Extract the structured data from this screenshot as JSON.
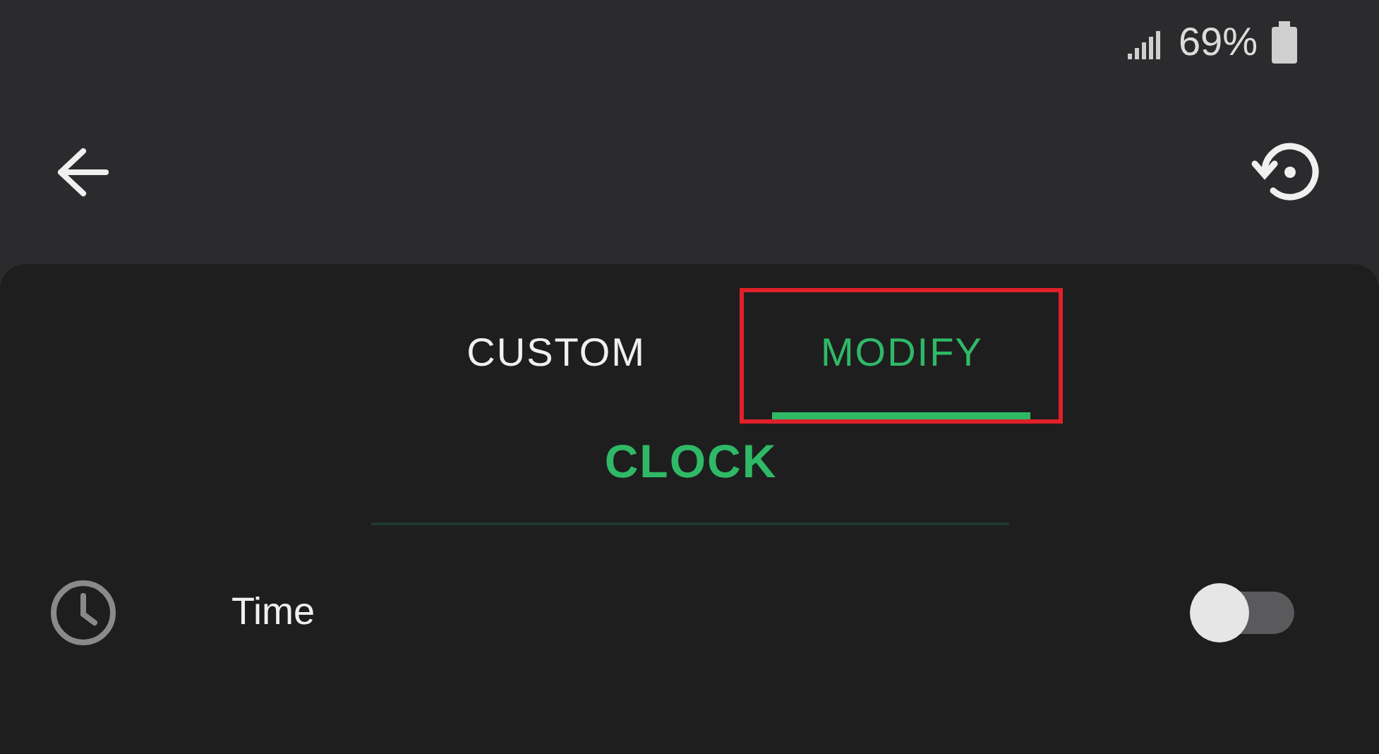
{
  "status_bar": {
    "battery": "69%"
  },
  "tabs": [
    {
      "label": "CUSTOM",
      "selected": false,
      "highlighted": false
    },
    {
      "label": "MODIFY",
      "selected": true,
      "highlighted": true
    }
  ],
  "section": {
    "title": "CLOCK"
  },
  "settings": [
    {
      "label": "Time",
      "on": false
    }
  ]
}
